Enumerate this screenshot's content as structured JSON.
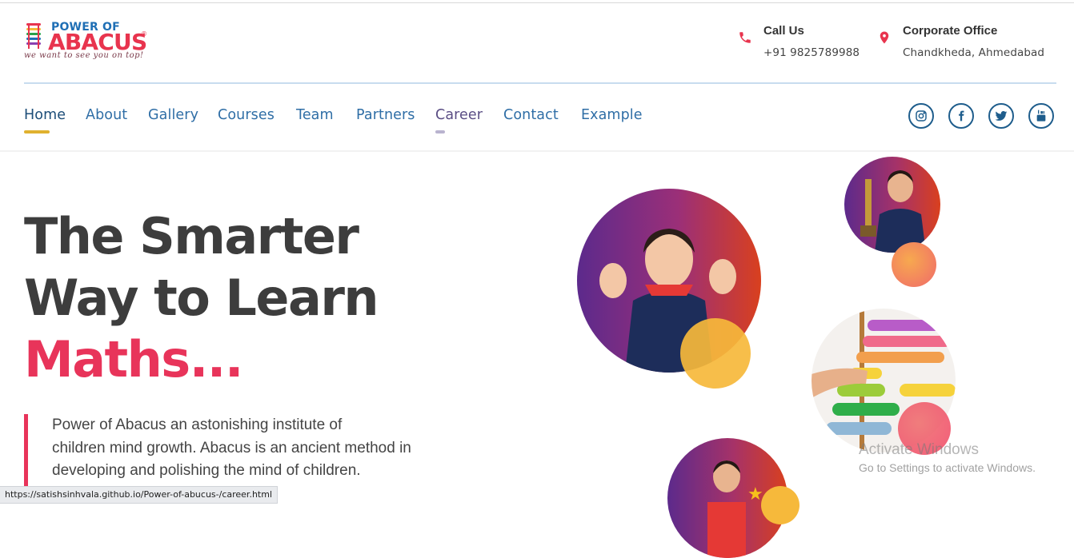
{
  "brand": {
    "name_top": "POWER OF",
    "name_main": "ABACUS",
    "registered": "®",
    "tagline": "we want to see you on top!"
  },
  "contacts": [
    {
      "title": "Call Us",
      "value": "+91 9825789988",
      "icon": "phone-icon"
    },
    {
      "title": "Corporate Office",
      "value": "Chandkheda, Ahmedabad",
      "icon": "location-pin-icon"
    }
  ],
  "nav": {
    "items": [
      {
        "label": "Home",
        "active": true
      },
      {
        "label": "About"
      },
      {
        "label": "Gallery"
      },
      {
        "label": "Courses"
      },
      {
        "label": "Team"
      },
      {
        "label": "Partners"
      },
      {
        "label": "Career",
        "hover": true
      },
      {
        "label": "Contact"
      },
      {
        "label": "Example"
      }
    ]
  },
  "social": [
    "instagram-icon",
    "facebook-icon",
    "twitter-icon",
    "youtube-icon"
  ],
  "hero": {
    "line1": "The Smarter",
    "line2": "Way to Learn",
    "line3": "Maths...",
    "para_lines": [
      "Power of Abacus an astonishing institute of",
      "children mind growth. Abacus is an ancient method in",
      "developing and polishing the mind of children."
    ]
  },
  "status_url": "https://satishsinhvala.github.io/Power-of-abucus-/career.html",
  "watermark": {
    "title": "Activate Windows",
    "subtitle": "Go to Settings to activate Windows."
  },
  "colors": {
    "accent": "#e8345a",
    "nav_blue": "#2f6ea6",
    "active_underline": "#e0b12f",
    "career_underline": "#b9b3cf",
    "circle_gradient_start": "#5c2a8c",
    "circle_gradient_end": "#d9401e",
    "yellow_blob": "#f6b93b"
  }
}
